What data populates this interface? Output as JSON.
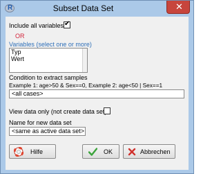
{
  "window": {
    "title": "Subset Data Set",
    "app_icon_letter": "R",
    "close_glyph": "✕"
  },
  "include_all": {
    "label": "Include all variables",
    "checked": "✔"
  },
  "or_label": "OR",
  "variables": {
    "label": "Variables (select one or more)",
    "items": [
      "Typ",
      "Wert"
    ]
  },
  "condition": {
    "label": "Condition to extract samples",
    "example": "Example 1: age>50 & Sex==0, Example 2: age<50 | Sex==1",
    "value": "<all cases>"
  },
  "view_only": {
    "label": "View data only (not create data set)"
  },
  "new_name": {
    "label": "Name for new data set",
    "value": "<same as active data set>"
  },
  "buttons": {
    "help": "Hilfe",
    "ok": "OK",
    "cancel": "Abbrechen"
  },
  "colors": {
    "accent_red": "#d2233a",
    "accent_blue": "#2e6fb8",
    "ok_green": "#3aa33a",
    "cancel_red": "#d0312d"
  }
}
